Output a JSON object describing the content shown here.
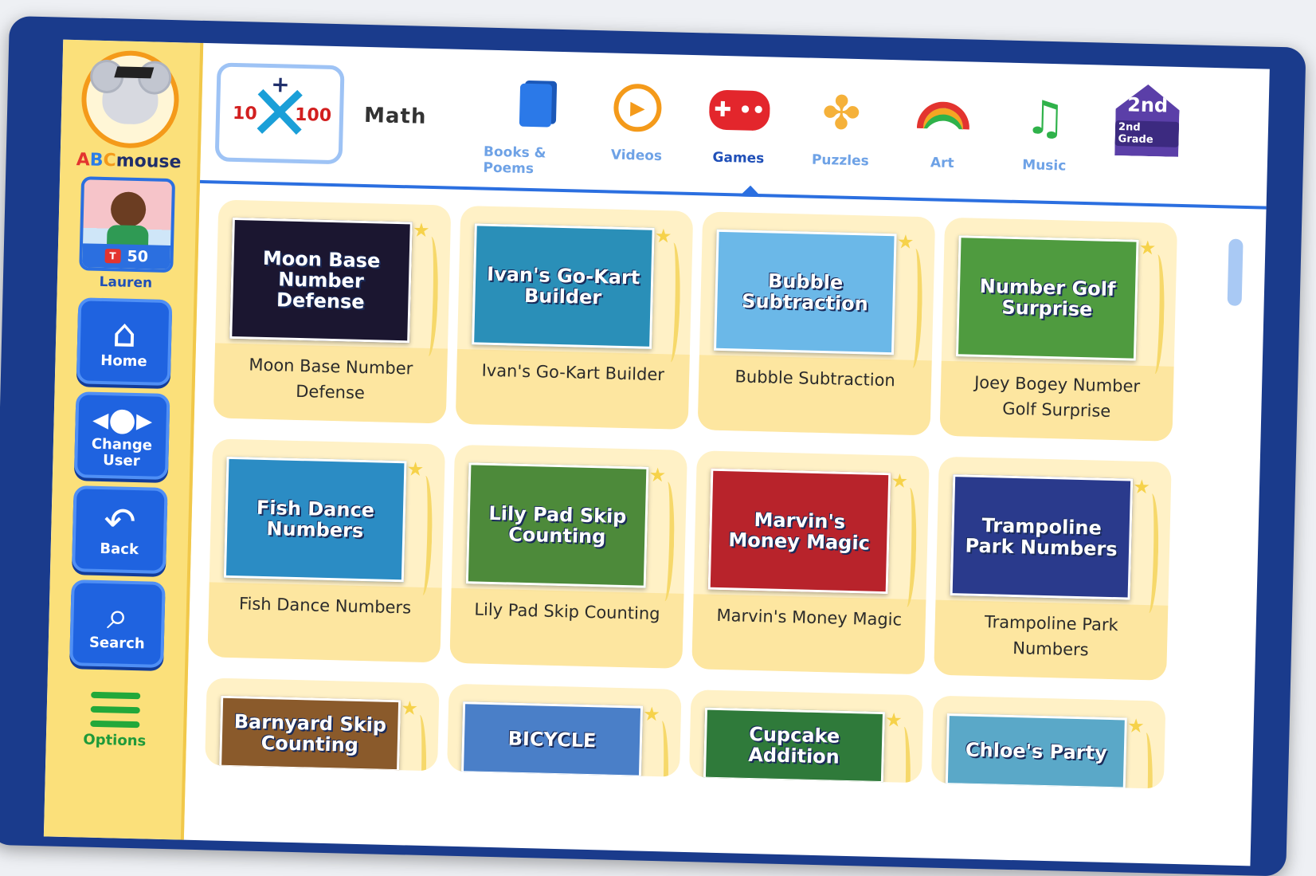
{
  "app": {
    "logo_text_a": "A",
    "logo_text_b": "B",
    "logo_text_c": "C",
    "logo_text_rest": "mouse"
  },
  "user": {
    "name": "Lauren",
    "tickets": "50",
    "ticket_icon_label": "T"
  },
  "sidebar": {
    "buttons": [
      {
        "label": "Home",
        "icon": "home-icon"
      },
      {
        "label": "Change User",
        "icon": "change-user-icon"
      },
      {
        "label": "Back",
        "icon": "back-icon"
      },
      {
        "label": "Search",
        "icon": "search-icon"
      }
    ],
    "options_label": "Options"
  },
  "subject": {
    "title": "Math",
    "tile_left": "10",
    "tile_right": "100",
    "tile_top": "+"
  },
  "tabs": [
    {
      "label": "Books & Poems",
      "icon": "book-icon"
    },
    {
      "label": "Videos",
      "icon": "play-icon"
    },
    {
      "label": "Games",
      "icon": "gamepad-icon",
      "active": true
    },
    {
      "label": "Puzzles",
      "icon": "puzzle-icon"
    },
    {
      "label": "Art",
      "icon": "rainbow-icon"
    },
    {
      "label": "Music",
      "icon": "music-note-icon"
    }
  ],
  "grade": {
    "badge": "2nd",
    "label": "2nd Grade"
  },
  "games": [
    {
      "title": "Moon Base Number Defense",
      "thumb": "Moon Base Number Defense",
      "color": "#1b1630"
    },
    {
      "title": "Ivan's Go-Kart Builder",
      "thumb": "Ivan's Go-Kart Builder",
      "color": "#2a8fb8"
    },
    {
      "title": "Bubble Subtraction",
      "thumb": "Bubble Subtraction",
      "color": "#6bb8e8"
    },
    {
      "title": "Joey Bogey Number Golf Surprise",
      "thumb": "Number Golf Surprise",
      "color": "#4f9b3f"
    },
    {
      "title": "Fish Dance Numbers",
      "thumb": "Fish Dance Numbers",
      "color": "#2b8cc4"
    },
    {
      "title": "Lily Pad Skip Counting",
      "thumb": "Lily Pad Skip Counting",
      "color": "#4d8a3a"
    },
    {
      "title": "Marvin's Money Magic",
      "thumb": "Marvin's Money Magic",
      "color": "#b8232b"
    },
    {
      "title": "Trampoline Park Numbers",
      "thumb": "Trampoline Park Numbers",
      "color": "#2a3a8c"
    },
    {
      "title": "",
      "thumb": "Barnyard Skip Counting",
      "color": "#8a5a2b"
    },
    {
      "title": "",
      "thumb": "BICYCLE",
      "color": "#4a7fc8"
    },
    {
      "title": "",
      "thumb": "Cupcake Addition",
      "color": "#2f7a3a"
    },
    {
      "title": "",
      "thumb": "Chloe's Party",
      "color": "#5aa8c8"
    }
  ]
}
